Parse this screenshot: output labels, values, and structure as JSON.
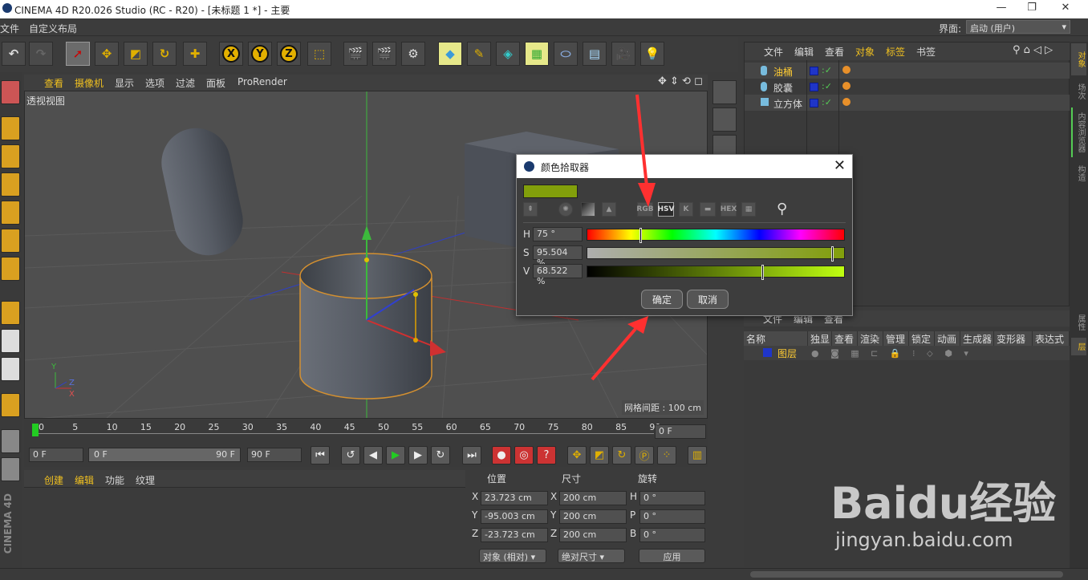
{
  "app": {
    "title": "CINEMA 4D R20.026 Studio (RC - R20) - [未标题 1 *] - 主要",
    "window_buttons": {
      "minimize": "—",
      "restore": "❐",
      "close": "✕"
    }
  },
  "menubar": {
    "items": [
      "文件",
      "自定义布局"
    ],
    "layout_label": "界面:",
    "layout_value": "启动 (用户)"
  },
  "toolbar": {
    "axis_x": "X",
    "axis_y": "Y",
    "axis_z": "Z"
  },
  "viewport": {
    "menu": [
      "查看",
      "摄像机",
      "显示",
      "选项",
      "过滤",
      "面板",
      "ProRender"
    ],
    "label": "透视视图",
    "grid_spacing": "网格间距 : 100 cm",
    "axis_y": "Y",
    "axis_z": "Z",
    "axis_x": "X"
  },
  "object_manager": {
    "menu": [
      "文件",
      "编辑",
      "查看",
      "对象",
      "标签",
      "书签"
    ],
    "objects": [
      {
        "name": "油桶",
        "color": "#ffcc33"
      },
      {
        "name": "胶囊",
        "color": "#d8d8d8"
      },
      {
        "name": "立方体",
        "color": "#d8d8d8"
      }
    ]
  },
  "layer_manager": {
    "menu": [
      "文件",
      "编辑",
      "查看"
    ],
    "columns": [
      "名称",
      "独显",
      "查看",
      "渲染",
      "管理",
      "锁定",
      "动画",
      "生成器",
      "变形器",
      "表达式"
    ],
    "layer_name": "图层"
  },
  "right_tabs": {
    "top": [
      "对象",
      "场次",
      "内容浏览器",
      "构造"
    ],
    "bottom": [
      "属性",
      "层"
    ]
  },
  "timeline": {
    "ticks": [
      "0",
      "5",
      "10",
      "15",
      "20",
      "25",
      "30",
      "35",
      "40",
      "45",
      "50",
      "55",
      "60",
      "65",
      "70",
      "75",
      "80",
      "85",
      "90"
    ],
    "current_frame": "0 F"
  },
  "transport": {
    "start": "0 F",
    "range_start": "0 F",
    "range_end": "90 F",
    "end": "90 F"
  },
  "material_manager": {
    "menu": [
      "创建",
      "编辑",
      "功能",
      "纹理"
    ]
  },
  "coordinates": {
    "headers": {
      "position": "位置",
      "size": "尺寸",
      "rotation": "旋转"
    },
    "rows": [
      {
        "axis": "X",
        "pos": "23.723 cm",
        "size_axis": "X",
        "size": "200 cm",
        "rot_axis": "H",
        "rot": "0 °"
      },
      {
        "axis": "Y",
        "pos": "-95.003 cm",
        "size_axis": "Y",
        "size": "200 cm",
        "rot_axis": "P",
        "rot": "0 °"
      },
      {
        "axis": "Z",
        "pos": "-23.723 cm",
        "size_axis": "Z",
        "size": "200 cm",
        "rot_axis": "B",
        "rot": "0 °"
      }
    ],
    "mode": "对象 (相对)",
    "size_mode": "绝对尺寸",
    "apply": "应用"
  },
  "color_picker": {
    "title": "颜色拾取器",
    "swatch_color": "#829f0b",
    "modes": [
      "RGB",
      "HSV",
      "K",
      "",
      "HEX",
      ""
    ],
    "active_mode": "HSV",
    "h_label": "H",
    "h_value": "75 °",
    "h_fraction": 0.2083,
    "s_label": "S",
    "s_value": "95.504 %",
    "s_fraction": 0.95504,
    "v_label": "V",
    "v_value": "68.522 %",
    "v_fraction": 0.68522,
    "ok": "确定",
    "cancel": "取消"
  },
  "side_logo": "CINEMA 4D",
  "watermark": {
    "brand": "Baidu经验",
    "url": "jingyan.baidu.com"
  }
}
